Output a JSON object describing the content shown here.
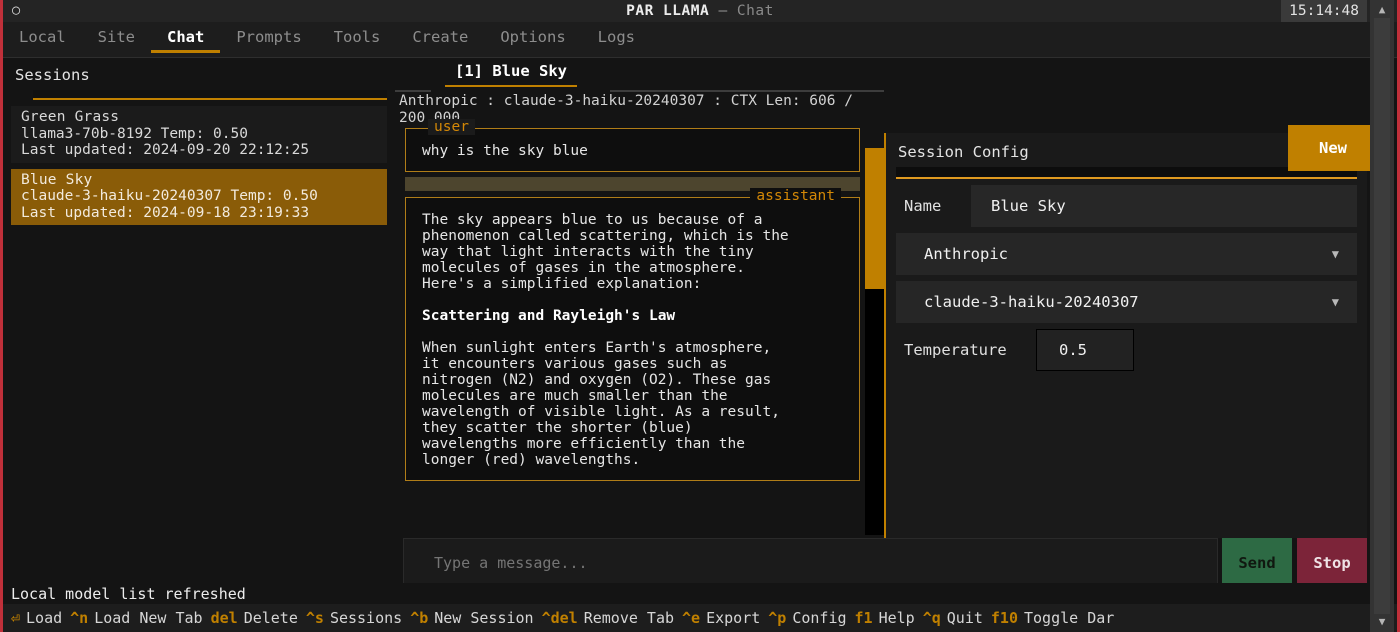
{
  "titlebar": {
    "logo_icon": "circle-icon",
    "app_name": "PAR LLAMA",
    "dash": "—",
    "subtitle": "Chat",
    "clock": "15:14:48"
  },
  "tabs": [
    {
      "label": "Local",
      "active": false
    },
    {
      "label": "Site",
      "active": false
    },
    {
      "label": "Chat",
      "active": true
    },
    {
      "label": "Prompts",
      "active": false
    },
    {
      "label": "Tools",
      "active": false
    },
    {
      "label": "Create",
      "active": false
    },
    {
      "label": "Options",
      "active": false
    },
    {
      "label": "Logs",
      "active": false
    }
  ],
  "sessions_panel": {
    "title": "Sessions",
    "items": [
      {
        "name": "Green Grass",
        "model_line": "llama3-70b-8192 Temp: 0.50",
        "updated_line": "Last updated: 2024-09-20 22:12:25",
        "selected": false
      },
      {
        "name": "Blue Sky",
        "model_line": "claude-3-haiku-20240307 Temp: 0.50",
        "updated_line": "Last updated: 2024-09-18 23:19:33",
        "selected": true
      }
    ]
  },
  "chat_panel": {
    "tab_label": "[1] Blue Sky",
    "meta": "Anthropic : claude-3-haiku-20240307 : CTX Len: 606 / 200,000",
    "messages": [
      {
        "role_label": "user",
        "label_side": "left",
        "text": "why is the sky blue"
      },
      {
        "role_label": "assistant",
        "label_side": "right",
        "paragraphs": [
          "The sky appears blue to us because of a\nphenomenon called scattering, which is the\nway that light interacts with the tiny\nmolecules of gases in the atmosphere.\nHere's a simplified explanation:",
          "Scattering and Rayleigh's Law",
          "When sunlight enters Earth's atmosphere,\nit encounters various gases such as\nnitrogen (N2) and oxygen (O2). These gas\nmolecules are much smaller than the\nwavelength of visible light. As a result,\nthey scatter the shorter (blue)\nwavelengths more efficiently than the\nlonger (red) wavelengths."
        ]
      }
    ]
  },
  "input_row": {
    "placeholder": "Type a message...",
    "value": "",
    "send_label": "Send",
    "stop_label": "Stop"
  },
  "config_panel": {
    "title": "Session Config",
    "new_button": "New",
    "name_label": "Name",
    "name_value": "Blue Sky",
    "provider_value": "Anthropic",
    "provider_caret_icon": "chevron-down-icon",
    "model_value": "claude-3-haiku-20240307",
    "model_caret_icon": "chevron-down-icon",
    "temperature_label": "Temperature",
    "temperature_value": "0.5"
  },
  "status": {
    "message": "Local model list refreshed"
  },
  "footer": {
    "shortcuts": [
      {
        "key": "⏎",
        "label": "Load"
      },
      {
        "key": "^n",
        "label": "Load New Tab"
      },
      {
        "key": "del",
        "label": "Delete"
      },
      {
        "key": "^s",
        "label": "Sessions"
      },
      {
        "key": "^b",
        "label": "New Session"
      },
      {
        "key": "^del",
        "label": "Remove Tab"
      },
      {
        "key": "^e",
        "label": "Export"
      },
      {
        "key": "^p",
        "label": "Config"
      },
      {
        "key": "f1",
        "label": "Help"
      },
      {
        "key": "^q",
        "label": "Quit"
      },
      {
        "key": "f10",
        "label": "Toggle Dar"
      }
    ]
  },
  "scrollbar": {
    "up_arrow_icon": "triangle-up-icon",
    "down_arrow_icon": "triangle-down-icon"
  },
  "colors": {
    "accent": "#c08000",
    "border_red": "#c0303a",
    "selected_session": "#8a5c08",
    "send_green": "#2d6a44",
    "stop_red": "#7c2439"
  }
}
